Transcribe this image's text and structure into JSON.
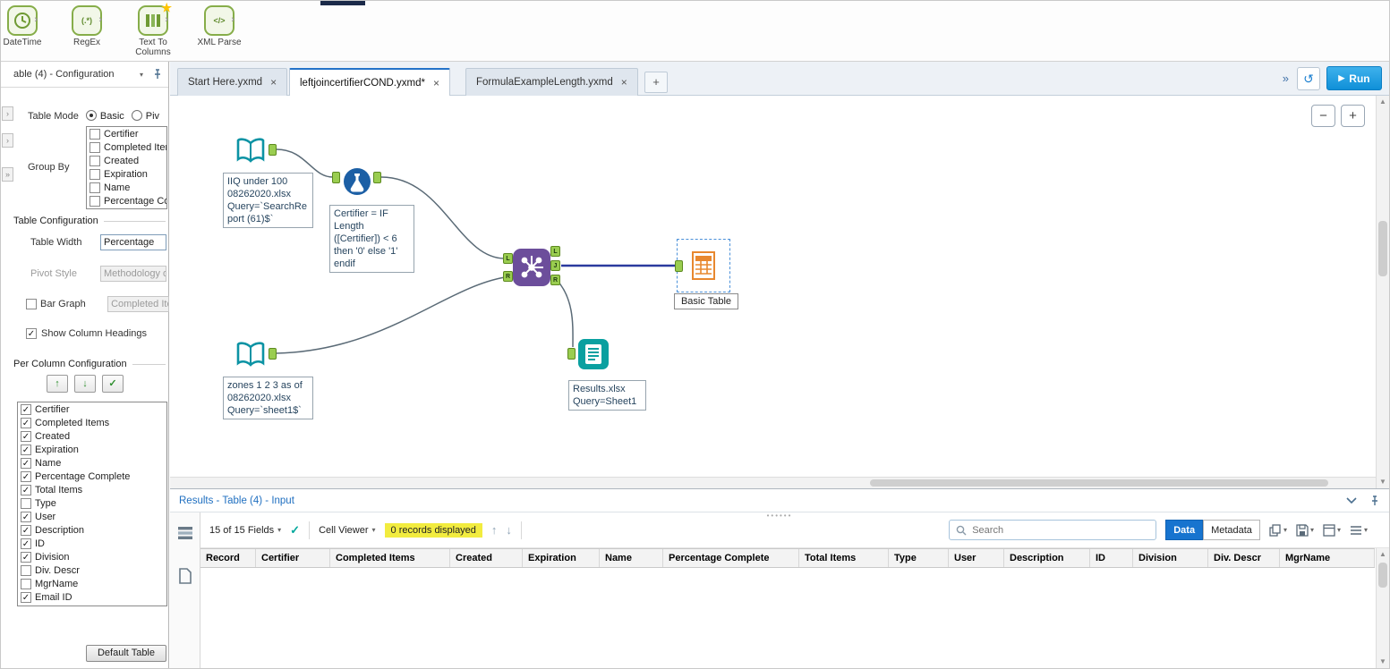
{
  "icons": {
    "close": "×",
    "add_tab": "+",
    "overflow": "»",
    "history": "↺",
    "run_play": "▶",
    "dropdown": "▾",
    "up_arrow": "↑",
    "down_arrow": "↓",
    "check": "✓",
    "star": "★",
    "drag": "›",
    "zoom_in": "+",
    "zoom_out": "−",
    "grip": "••••••",
    "sb_up": "▲",
    "sb_down": "▼"
  },
  "palette": {
    "tools": [
      {
        "label": "DateTime",
        "glyph": ""
      },
      {
        "label": "RegEx",
        "glyph": "(.*)"
      },
      {
        "label": "Text To Columns",
        "glyph": ""
      },
      {
        "label": "XML Parse",
        "glyph": "</>"
      }
    ]
  },
  "tabbar": {
    "tabs": [
      {
        "label": "Start Here.yxmd"
      },
      {
        "label": "leftjoincertifierCOND.yxmd*"
      },
      {
        "label": "FormulaExampleLength.yxmd"
      }
    ],
    "run_label": "Run"
  },
  "config": {
    "title": "able (4) - Configuration",
    "table_mode": {
      "label": "Table Mode",
      "option_basic": "Basic",
      "option_pivot": "Piv"
    },
    "group_by": {
      "label": "Group By",
      "items": [
        {
          "label": "Certifier",
          "check": ""
        },
        {
          "label": "Completed Item",
          "check": ""
        },
        {
          "label": "Created",
          "check": ""
        },
        {
          "label": "Expiration",
          "check": ""
        },
        {
          "label": "Name",
          "check": ""
        },
        {
          "label": "Percentage Co",
          "check": ""
        }
      ]
    },
    "table_configuration": {
      "header": "Table Configuration",
      "table_width_label": "Table Width",
      "table_width_value": "Percentage",
      "pivot_style_label": "Pivot Style",
      "pivot_style_value": "Methodology o",
      "bar_graph_label": "Bar Graph",
      "bar_graph_check": "",
      "bar_graph_value": "Completed Ite",
      "show_column_headings_label": "Show Column Headings",
      "show_column_headings_check": "✓"
    },
    "per_column": {
      "header": "Per Column Configuration",
      "columns": [
        {
          "label": "Certifier",
          "check": "✓"
        },
        {
          "label": "Completed Items",
          "check": "✓"
        },
        {
          "label": "Created",
          "check": "✓"
        },
        {
          "label": "Expiration",
          "check": "✓"
        },
        {
          "label": "Name",
          "check": "✓"
        },
        {
          "label": "Percentage Complete",
          "check": "✓"
        },
        {
          "label": "Total Items",
          "check": "✓"
        },
        {
          "label": "Type",
          "check": ""
        },
        {
          "label": "User",
          "check": "✓"
        },
        {
          "label": "Description",
          "check": "✓"
        },
        {
          "label": "ID",
          "check": "✓"
        },
        {
          "label": "Division",
          "check": "✓"
        },
        {
          "label": "Div. Descr",
          "check": ""
        },
        {
          "label": "MgrName",
          "check": ""
        },
        {
          "label": "Email ID",
          "check": "✓"
        }
      ]
    },
    "default_table_button": "Default Table"
  },
  "canvas": {
    "input1_annotation": "IIQ under 100\n08262020.xlsx\nQuery=`SearchRe\nport (61)$`",
    "formula_annotation": "Certifier = IF\nLength\n([Certifier]) < 6\nthen '0' else '1'\nendif",
    "input2_annotation": "zones 1 2 3 as of\n08262020.xlsx\nQuery=`sheet1$`",
    "output_annotation": "Results.xlsx\nQuery=Sheet1",
    "table_label": "Basic Table",
    "join_ports_left": [
      "L",
      "R"
    ],
    "join_ports_right": [
      "L",
      "J",
      "R"
    ]
  },
  "results": {
    "title": "Results - Table (4) - Input",
    "fields_summary": "15 of 15 Fields",
    "cell_viewer_label": "Cell Viewer",
    "records_displayed": "0 records displayed",
    "search_placeholder": "Search",
    "data_button": "Data",
    "metadata_button": "Metadata",
    "columns": [
      "Record",
      "Certifier",
      "Completed Items",
      "Created",
      "Expiration",
      "Name",
      "Percentage Complete",
      "Total Items",
      "Type",
      "User",
      "Description",
      "ID",
      "Division",
      "Div. Descr",
      "MgrName"
    ]
  }
}
